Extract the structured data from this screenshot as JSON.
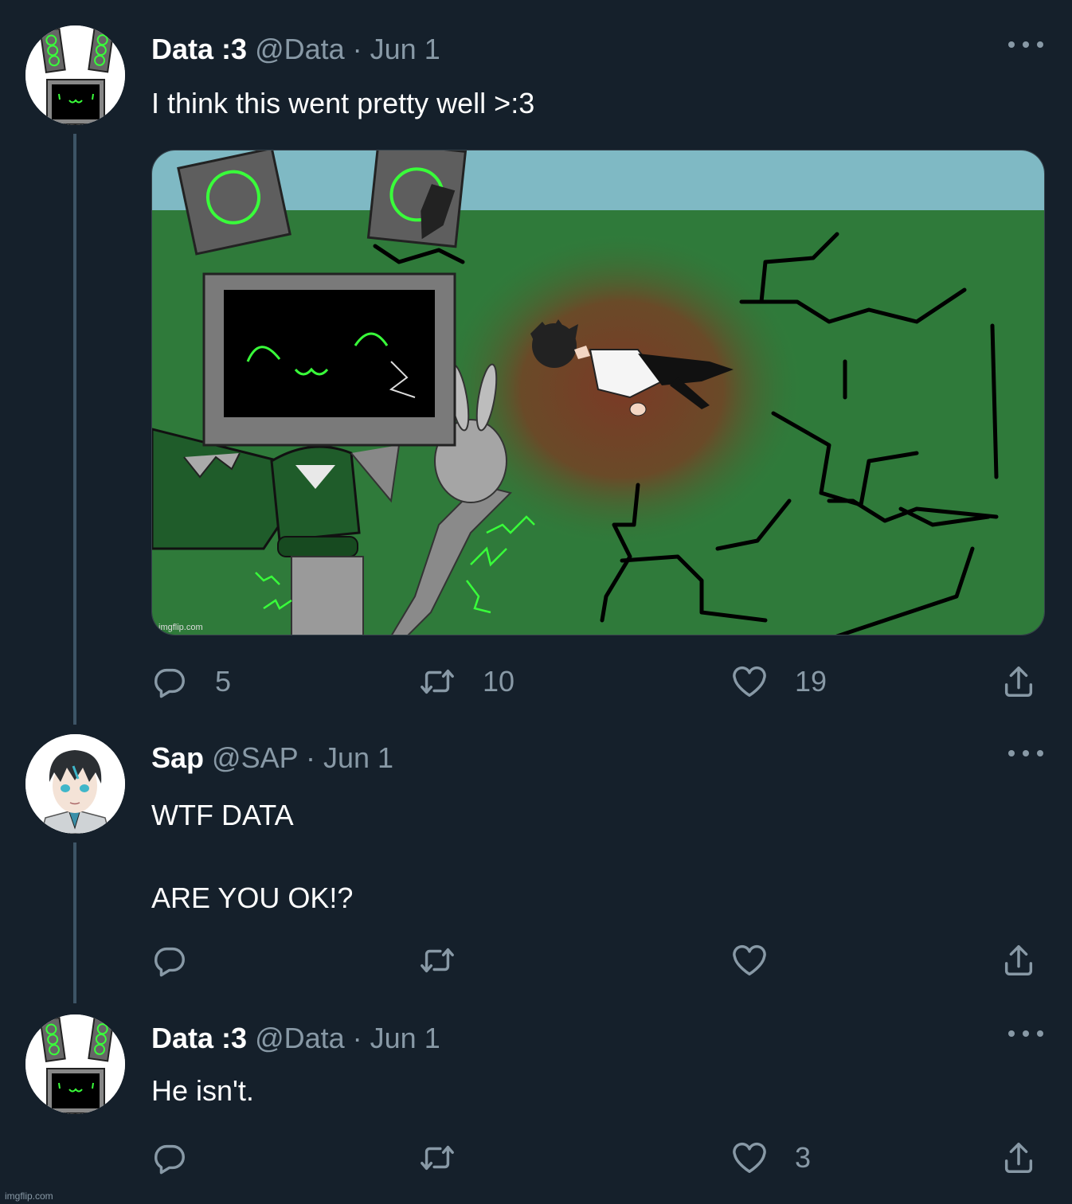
{
  "tweets": [
    {
      "name": "Data :3",
      "meta": "@Data · Jun 1",
      "text": "I think this went pretty well >:3",
      "replies": "5",
      "retweets": "10",
      "likes": "19",
      "media_watermark": "imgflip.com"
    },
    {
      "name": "Sap",
      "meta": "@SAP · Jun 1",
      "text": "WTF DATA\n\nARE YOU OK!?",
      "replies": "",
      "retweets": "",
      "likes": ""
    },
    {
      "name": "Data :3",
      "meta": "@Data · Jun 1",
      "text": "He isn't.",
      "replies": "",
      "retweets": "",
      "likes": "3"
    }
  ],
  "footer_watermark": "imgflip.com",
  "colors": {
    "background": "#15202b",
    "secondary_text": "#8899a6",
    "thread_line": "#3d5466",
    "accent_green": "#39ff3a"
  },
  "icons": [
    "more-icon",
    "reply-icon",
    "retweet-icon",
    "like-icon",
    "share-icon"
  ]
}
